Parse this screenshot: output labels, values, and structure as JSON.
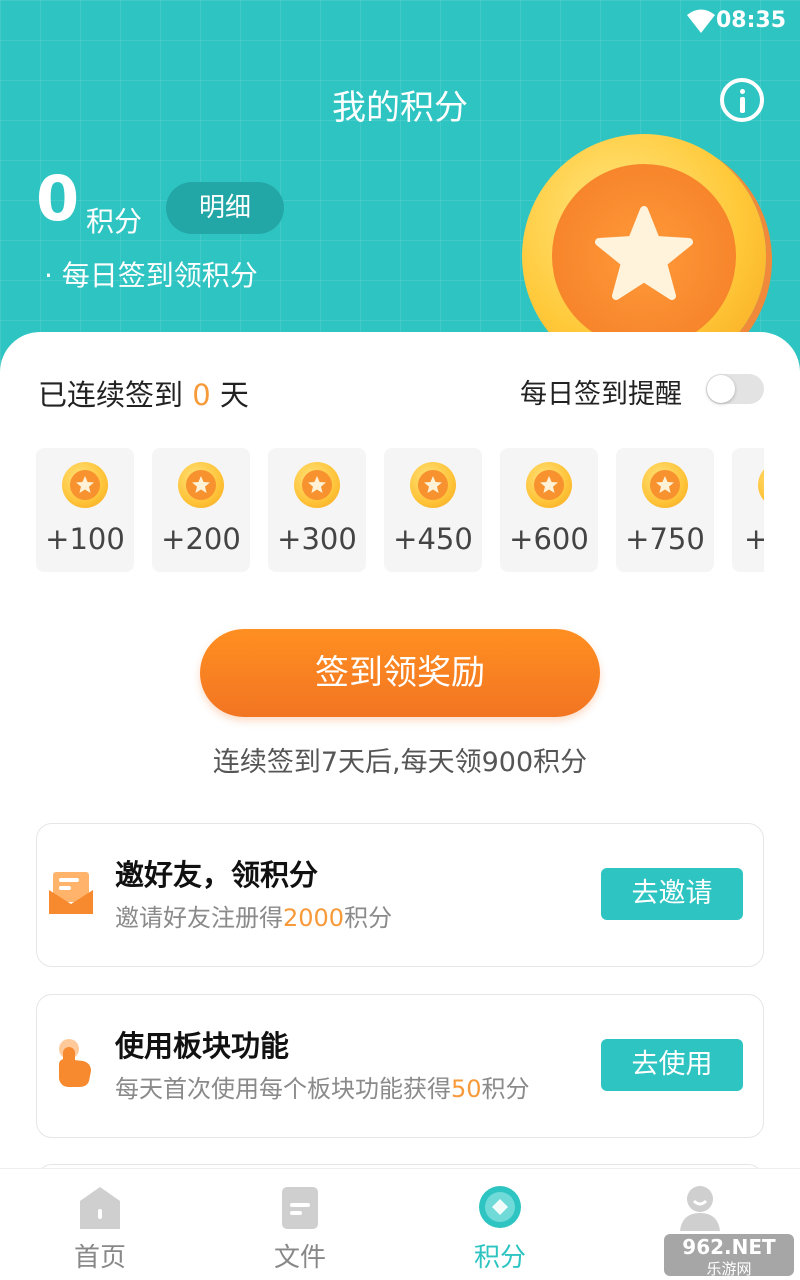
{
  "status_bar": {
    "time": "08:35"
  },
  "header": {
    "title": "我的积分",
    "points_value": "0",
    "points_unit": "积分",
    "detail_button": "明细",
    "subtitle": "· 每日签到领积分"
  },
  "checkin": {
    "streak_prefix": "已连续签到",
    "streak_days": "0",
    "streak_suffix": "天",
    "reminder_label": "每日签到提醒",
    "reminder_enabled": false,
    "rewards": [
      "+100",
      "+200",
      "+300",
      "+450",
      "+600",
      "+750",
      "+"
    ],
    "sign_button": "签到领奖励",
    "hint": "连续签到7天后,每天领900积分"
  },
  "tasks": [
    {
      "title": "邀好友，领积分",
      "desc_prefix": "邀请好友注册得",
      "desc_highlight": "2000",
      "desc_suffix": "积分",
      "button": "去邀请",
      "icon": "envelope-icon"
    },
    {
      "title": "使用板块功能",
      "desc_prefix": "每天首次使用每个板块功能获得",
      "desc_highlight": "50",
      "desc_suffix": "积分",
      "button": "去使用",
      "icon": "tap-hand-icon"
    }
  ],
  "bottom_nav": [
    {
      "label": "首页",
      "icon": "home-icon",
      "active": false
    },
    {
      "label": "文件",
      "icon": "file-icon",
      "active": false
    },
    {
      "label": "积分",
      "icon": "points-icon",
      "active": true
    },
    {
      "label": "",
      "icon": "profile-icon",
      "active": false
    }
  ],
  "watermark": {
    "line1": "962.NET",
    "line2": "乐游网"
  },
  "colors": {
    "accent": "#2ec4c2",
    "orange": "#f79a3a",
    "button_orange": "#ff8f21"
  }
}
